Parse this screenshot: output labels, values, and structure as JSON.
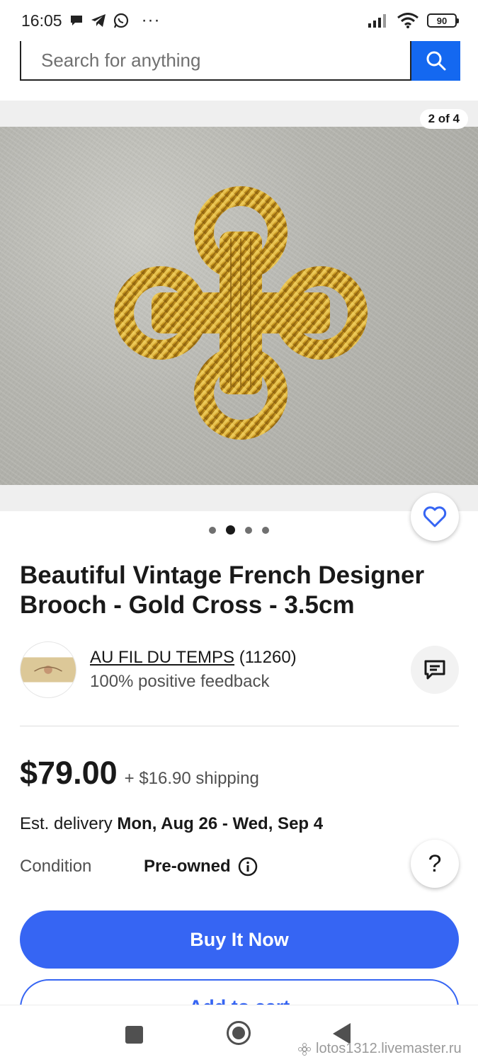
{
  "status_bar": {
    "time": "16:05",
    "more": "···",
    "battery": "90",
    "icons": [
      "message-bubble-icon",
      "telegram-icon",
      "whatsapp-icon",
      "signal-icon",
      "wifi-icon",
      "battery-icon"
    ]
  },
  "search": {
    "placeholder": "Search for anything"
  },
  "gallery": {
    "counter": "2 of 4",
    "dot_count": 4,
    "active_dot": 1
  },
  "listing": {
    "title": "Beautiful Vintage French Designer Brooch - Gold Cross - 3.5cm",
    "price": "$79.00",
    "shipping": "+ $16.90 shipping",
    "delivery_label": "Est. delivery",
    "delivery_dates": "Mon, Aug 26 - Wed, Sep 4",
    "condition_label": "Condition",
    "condition_value": "Pre-owned"
  },
  "seller": {
    "name": "AU FIL DU TEMPS",
    "count": "(11260)",
    "feedback": "100% positive feedback"
  },
  "actions": {
    "buy_now": "Buy It Now",
    "add_to_cart": "Add to cart",
    "help": "?"
  },
  "watermark": {
    "text": "lotos1312.livemaster.ru"
  },
  "colors": {
    "primary_blue": "#3665f3",
    "search_blue": "#1468f0",
    "text_dark": "#191919",
    "text_muted": "#505050"
  }
}
